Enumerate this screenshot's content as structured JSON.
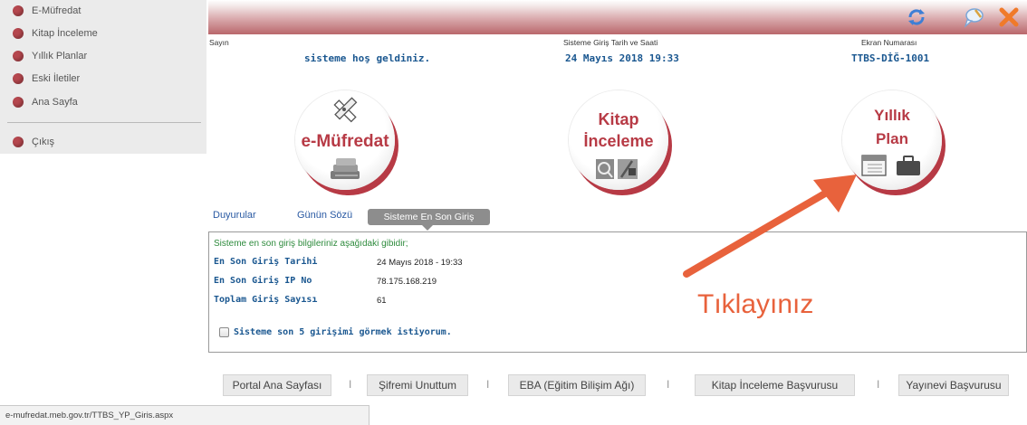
{
  "sidebar": {
    "items": [
      {
        "label": "E-Müfredat"
      },
      {
        "label": "Kitap İnceleme"
      },
      {
        "label": "Yıllık Planlar"
      },
      {
        "label": "Eski İletiler"
      },
      {
        "label": "Ana Sayfa"
      },
      {
        "label": "Çıkış"
      }
    ]
  },
  "header": {
    "greeting_label": "Sayın",
    "greeting_text": "sisteme hoş geldiniz.",
    "login_time_label": "Sisteme Giriş Tarih ve Saati",
    "login_time_value": "24 Mayıs 2018 19:33",
    "screen_label": "Ekran Numarası",
    "screen_value": "TTBS-DİĞ-1001",
    "icons": [
      "refresh-icon",
      "comment-icon",
      "close-icon"
    ]
  },
  "modules": {
    "emufredat": {
      "label": "e-Müfredat"
    },
    "kitap": {
      "line1": "Kitap",
      "line2": "İnceleme"
    },
    "yillik": {
      "line1": "Yıllık",
      "line2": "Plan"
    }
  },
  "tabs": [
    {
      "label": "Duyurular"
    },
    {
      "label": "Günün Sözü"
    },
    {
      "label": "Sisteme En Son Giriş",
      "active": true
    }
  ],
  "panel": {
    "intro": "Sisteme en son giriş bilgileriniz aşağıdaki gibidir;",
    "rows": [
      {
        "label": "En Son Giriş Tarihi",
        "value": "24 Mayıs 2018 - 19:33"
      },
      {
        "label": "En Son Giriş IP No",
        "value": "78.175.168.219"
      },
      {
        "label": "Toplam Giriş Sayısı",
        "value": "61"
      }
    ],
    "checkbox_label": "Sisteme son 5 girişimi görmek istiyorum.",
    "checkbox_checked": false
  },
  "annotation": {
    "text": "Tıklayınız",
    "color": "#e8623c"
  },
  "footer": {
    "links": [
      {
        "label": "Portal Ana Sayfası"
      },
      {
        "label": "Şifremi Unuttum"
      },
      {
        "label": "EBA (Eğitim Bilişim Ağı)"
      },
      {
        "label": "Kitap İnceleme Başvurusu"
      },
      {
        "label": "Yayınevi Başvurusu"
      }
    ],
    "separator": "I"
  },
  "statusbar": {
    "url": "e-mufredat.meb.gov.tr/TTBS_YP_Giris.aspx"
  },
  "colors": {
    "accent_red": "#b73a45",
    "link_blue": "#1a5790",
    "intro_green": "#2e8b3d",
    "annotation_orange": "#e8623c"
  }
}
